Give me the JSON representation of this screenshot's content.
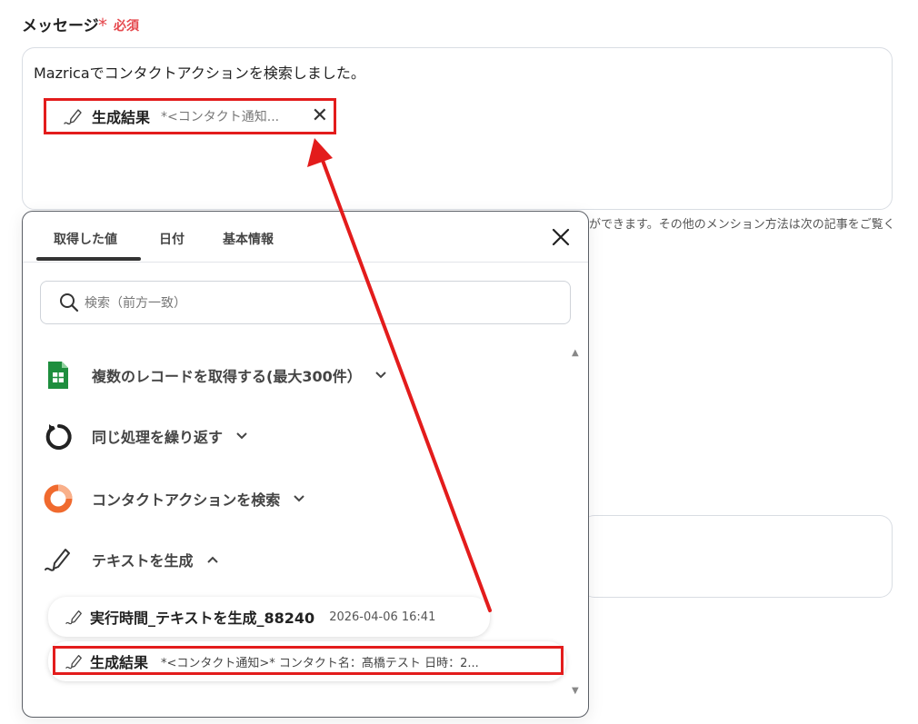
{
  "field": {
    "label": "メッセージ",
    "required_star": "*",
    "required_text": "必須"
  },
  "message": {
    "text": "Mazricaでコンタクトアクションを検索しました。",
    "chip": {
      "name": "生成結果",
      "preview": "*<コンタクト通知...",
      "close": "✕"
    }
  },
  "help_text": "ができます。その他のメンション方法は次の記事をご覧く",
  "panel": {
    "tabs": [
      "取得した値",
      "日付",
      "基本情報"
    ],
    "active_tab": 0,
    "search_placeholder": "検索（前方一致）",
    "sections": [
      {
        "label": "複数のレコードを取得する(最大300件）",
        "icon": "google-sheets-icon",
        "expanded": false
      },
      {
        "label": "同じ処理を繰り返す",
        "icon": "loop-icon",
        "expanded": false
      },
      {
        "label": "コンタクトアクションを検索",
        "icon": "mazrica-icon",
        "expanded": false
      },
      {
        "label": "テキストを生成",
        "icon": "pen-signature-icon",
        "expanded": true
      }
    ],
    "items": [
      {
        "name": "実行時間_テキストを生成_88240",
        "meta": "2026-04-06 16:41"
      },
      {
        "name": "生成結果",
        "preview": "*<コンタクト通知>* コンタクト名：髙橋テスト 日時：2..."
      }
    ]
  },
  "colors": {
    "highlight": "#e31c1c",
    "required": "#e5484d",
    "sheets_green": "#1e8e3e",
    "mazrica_orange": "#f06a2e"
  }
}
